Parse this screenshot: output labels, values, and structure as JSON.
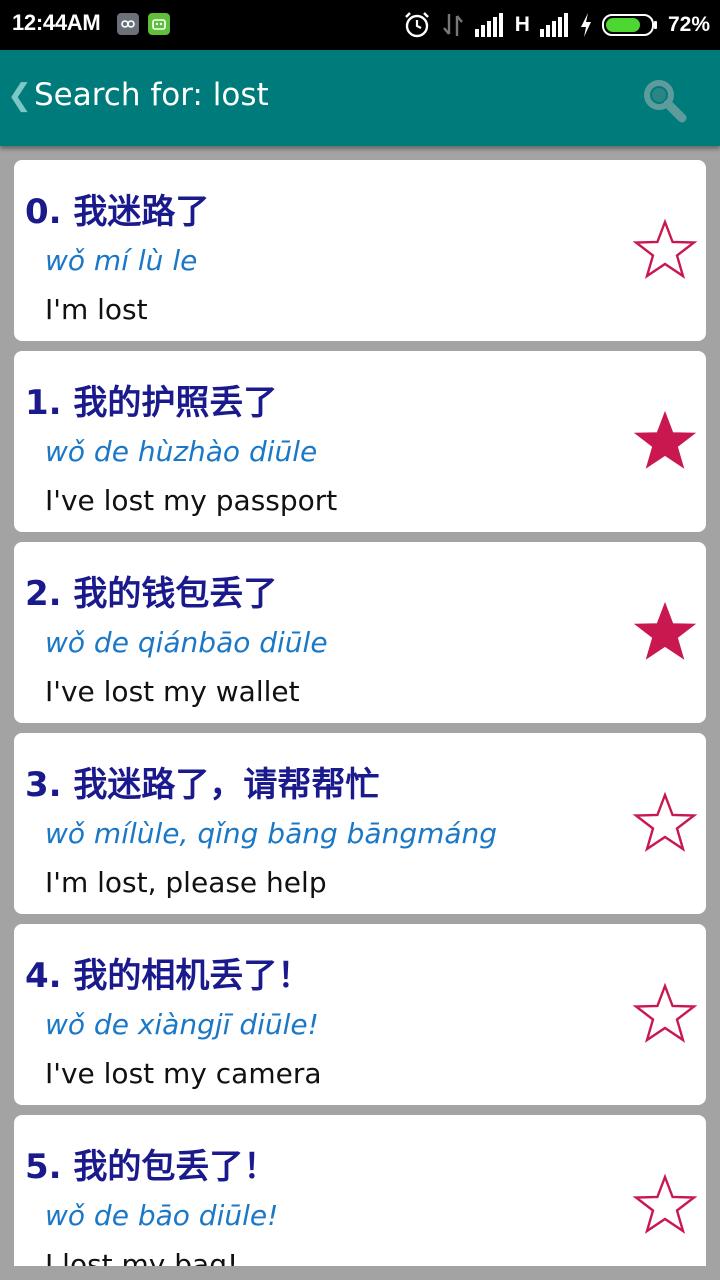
{
  "status_bar": {
    "time": "12:44AM",
    "network_type": "H",
    "battery_percent": "72%",
    "icons": [
      "app-icon-gray",
      "app-icon-green",
      "alarm-icon",
      "data-transfer-icon",
      "signal-icon",
      "signal-icon",
      "charging-icon",
      "battery-icon"
    ]
  },
  "action_bar": {
    "title": "Search for: lost",
    "back_icon": "chevron-left-icon",
    "search_icon": "search-icon",
    "color": "#007b7b"
  },
  "colors": {
    "hanzi": "#1a1a8c",
    "pinyin": "#1b78c6",
    "star": "#c8184f",
    "background": "#a3a3a3"
  },
  "results": [
    {
      "hanzi": "0. 我迷路了",
      "pinyin": "wǒ mí lù le",
      "english": "I'm lost",
      "favorite": false
    },
    {
      "hanzi": "1. 我的护照丢了",
      "pinyin": "wǒ de hùzhào diūle",
      "english": "I've lost my passport",
      "favorite": true
    },
    {
      "hanzi": "2. 我的钱包丢了",
      "pinyin": "wǒ de qiánbāo diūle",
      "english": "I've lost my wallet",
      "favorite": true
    },
    {
      "hanzi": "3. 我迷路了，请帮帮忙",
      "pinyin": "wǒ mílùle, qǐng bāng bāngmáng",
      "english": "I'm lost, please help",
      "favorite": false
    },
    {
      "hanzi": "4. 我的相机丢了！",
      "pinyin": "wǒ de xiàngjī diūle!",
      "english": "I've lost my camera",
      "favorite": false
    },
    {
      "hanzi": "5. 我的包丢了！",
      "pinyin": "wǒ de bāo diūle!",
      "english": "I lost my bag!",
      "favorite": false
    }
  ]
}
